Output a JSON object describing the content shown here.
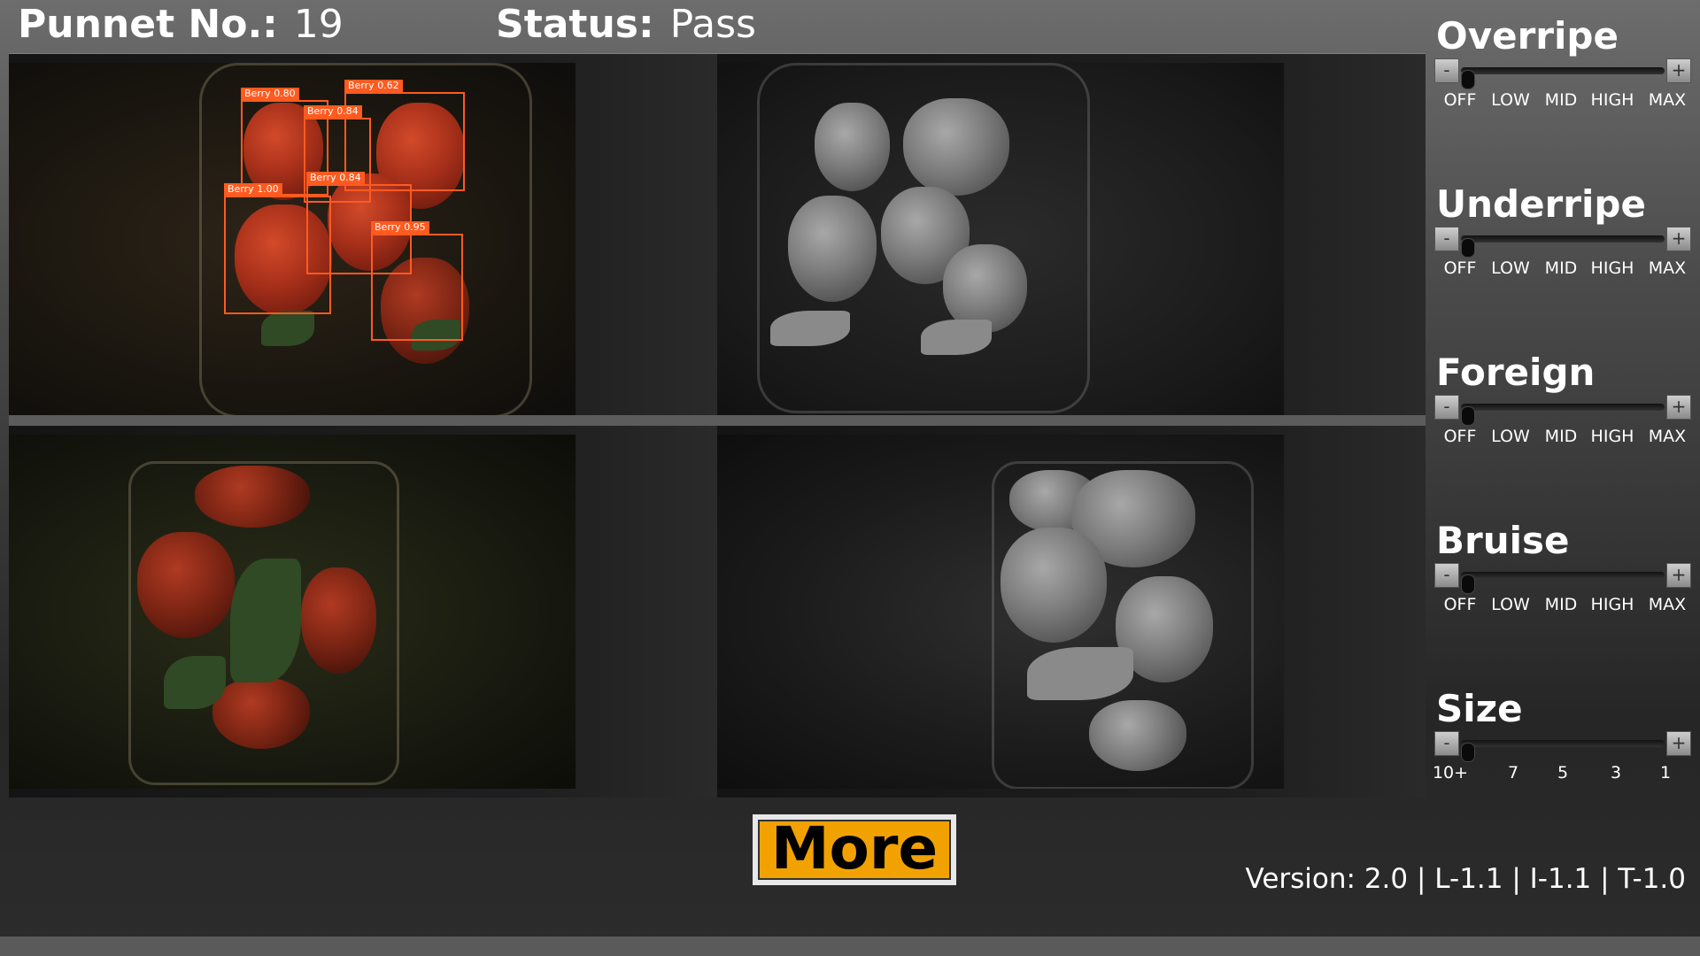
{
  "header": {
    "punnet_label": "Punnet No.:",
    "punnet_value": "19",
    "status_label": "Status:",
    "status_value": "Pass"
  },
  "cameras": {
    "rgb_top": {
      "detections": [
        {
          "label": "Berry",
          "score": "0.80"
        },
        {
          "label": "Berry",
          "score": "0.62"
        },
        {
          "label": "Berry",
          "score": "0.84"
        },
        {
          "label": "Berry",
          "score": "0.84"
        },
        {
          "label": "Berry",
          "score": "1.00"
        },
        {
          "label": "Berry",
          "score": "0.95"
        }
      ]
    }
  },
  "controls": [
    {
      "title": "Overripe",
      "level": 0,
      "ticks": [
        "OFF",
        "LOW",
        "MID",
        "HIGH",
        "MAX"
      ]
    },
    {
      "title": "Underripe",
      "level": 0,
      "ticks": [
        "OFF",
        "LOW",
        "MID",
        "HIGH",
        "MAX"
      ]
    },
    {
      "title": "Foreign",
      "level": 0,
      "ticks": [
        "OFF",
        "LOW",
        "MID",
        "HIGH",
        "MAX"
      ]
    },
    {
      "title": "Bruise",
      "level": 0,
      "ticks": [
        "OFF",
        "LOW",
        "MID",
        "HIGH",
        "MAX"
      ]
    },
    {
      "title": "Size",
      "level": 0,
      "ticks": [
        "10+",
        "7",
        "5",
        "3",
        "1"
      ]
    }
  ],
  "slider_buttons": {
    "minus": "-",
    "plus": "+"
  },
  "more_label": "More",
  "version_text": "Version:  2.0 | L-1.1 | I-1.1 | T-1.0"
}
